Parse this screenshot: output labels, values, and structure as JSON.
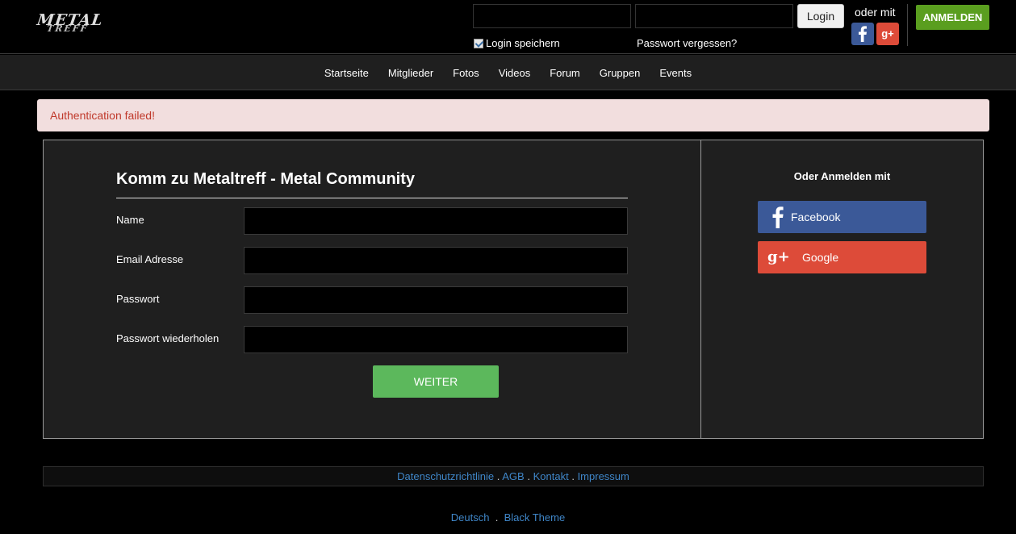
{
  "logo": {
    "line1": "METAL",
    "line2": "TREFF"
  },
  "header": {
    "login_username_value": "",
    "login_password_value": "",
    "login_button": "Login",
    "oder_mit": "oder mit",
    "anmelden_button": "ANMELDEN",
    "remember_label": "Login speichern",
    "remember_checked": true,
    "forgot_password": "Passwort vergessen?",
    "gplus_glyph": "g+"
  },
  "nav": {
    "items": [
      "Startseite",
      "Mitglieder",
      "Fotos",
      "Videos",
      "Forum",
      "Gruppen",
      "Events"
    ]
  },
  "alert": {
    "message": "Authentication failed!"
  },
  "form": {
    "title": "Komm zu Metaltreff - Metal Community",
    "fields": [
      {
        "label": "Name",
        "value": ""
      },
      {
        "label": "Email Adresse",
        "value": ""
      },
      {
        "label": "Passwort",
        "value": ""
      },
      {
        "label": "Passwort wiederholen",
        "value": ""
      }
    ],
    "submit": "WEITER"
  },
  "side": {
    "title": "Oder Anmelden mit",
    "facebook": "Facebook",
    "google": "Google",
    "gplus_glyph": "g+"
  },
  "footer": {
    "links": [
      "Datenschutzrichtlinie",
      "AGB",
      "Kontakt",
      "Impressum"
    ],
    "separator": ".",
    "language": "Deutsch",
    "theme": "Black Theme"
  },
  "colors": {
    "accent_green": "#5a9e1f",
    "button_green": "#5cb85c",
    "facebook": "#3b5998",
    "google": "#dd4b39",
    "link": "#3f86c8",
    "alert_bg": "#f2dede",
    "alert_text": "#c0392b"
  }
}
